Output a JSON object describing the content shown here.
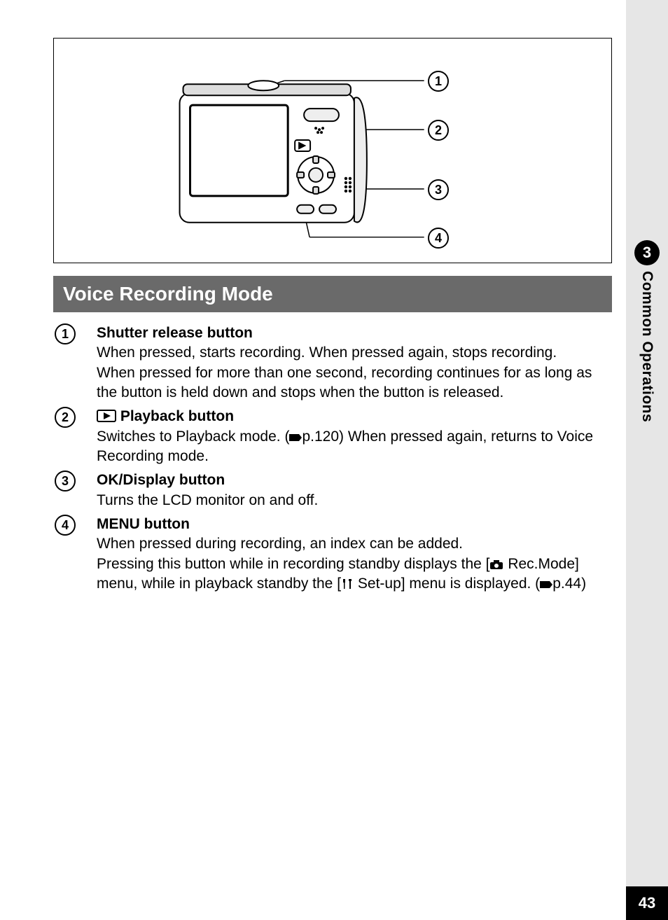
{
  "sideTab": {
    "chapterNumber": "3",
    "chapterTitle": "Common Operations"
  },
  "pageNumber": "43",
  "diagram": {
    "callouts": [
      "1",
      "2",
      "3",
      "4"
    ]
  },
  "section": {
    "title": "Voice Recording Mode",
    "items": [
      {
        "num": "1",
        "title": "Shutter release button",
        "body_a": "When pressed, starts recording. When pressed again, stops recording.",
        "body_b": "When pressed for more than one second, recording continues for as long as the button is held down and stops when the button is released."
      },
      {
        "num": "2",
        "title": " Playback button",
        "body_a_pre": "Switches to Playback mode. (",
        "body_a_ref": "p.120",
        "body_a_post": ") When pressed again, returns to Voice Recording mode."
      },
      {
        "num": "3",
        "title": "OK/Display button",
        "body_a": "Turns the LCD monitor on and off."
      },
      {
        "num": "4",
        "title": "MENU button",
        "body_a": "When pressed during recording, an index can be added.",
        "body_b_pre": "Pressing this button while in recording standby displays the [",
        "body_b_mid": " Rec.Mode] menu, while in playback standby the [",
        "body_b_end_pre": " Set-up] menu is displayed. (",
        "body_b_ref": "p.44",
        "body_b_post": ")"
      }
    ]
  }
}
